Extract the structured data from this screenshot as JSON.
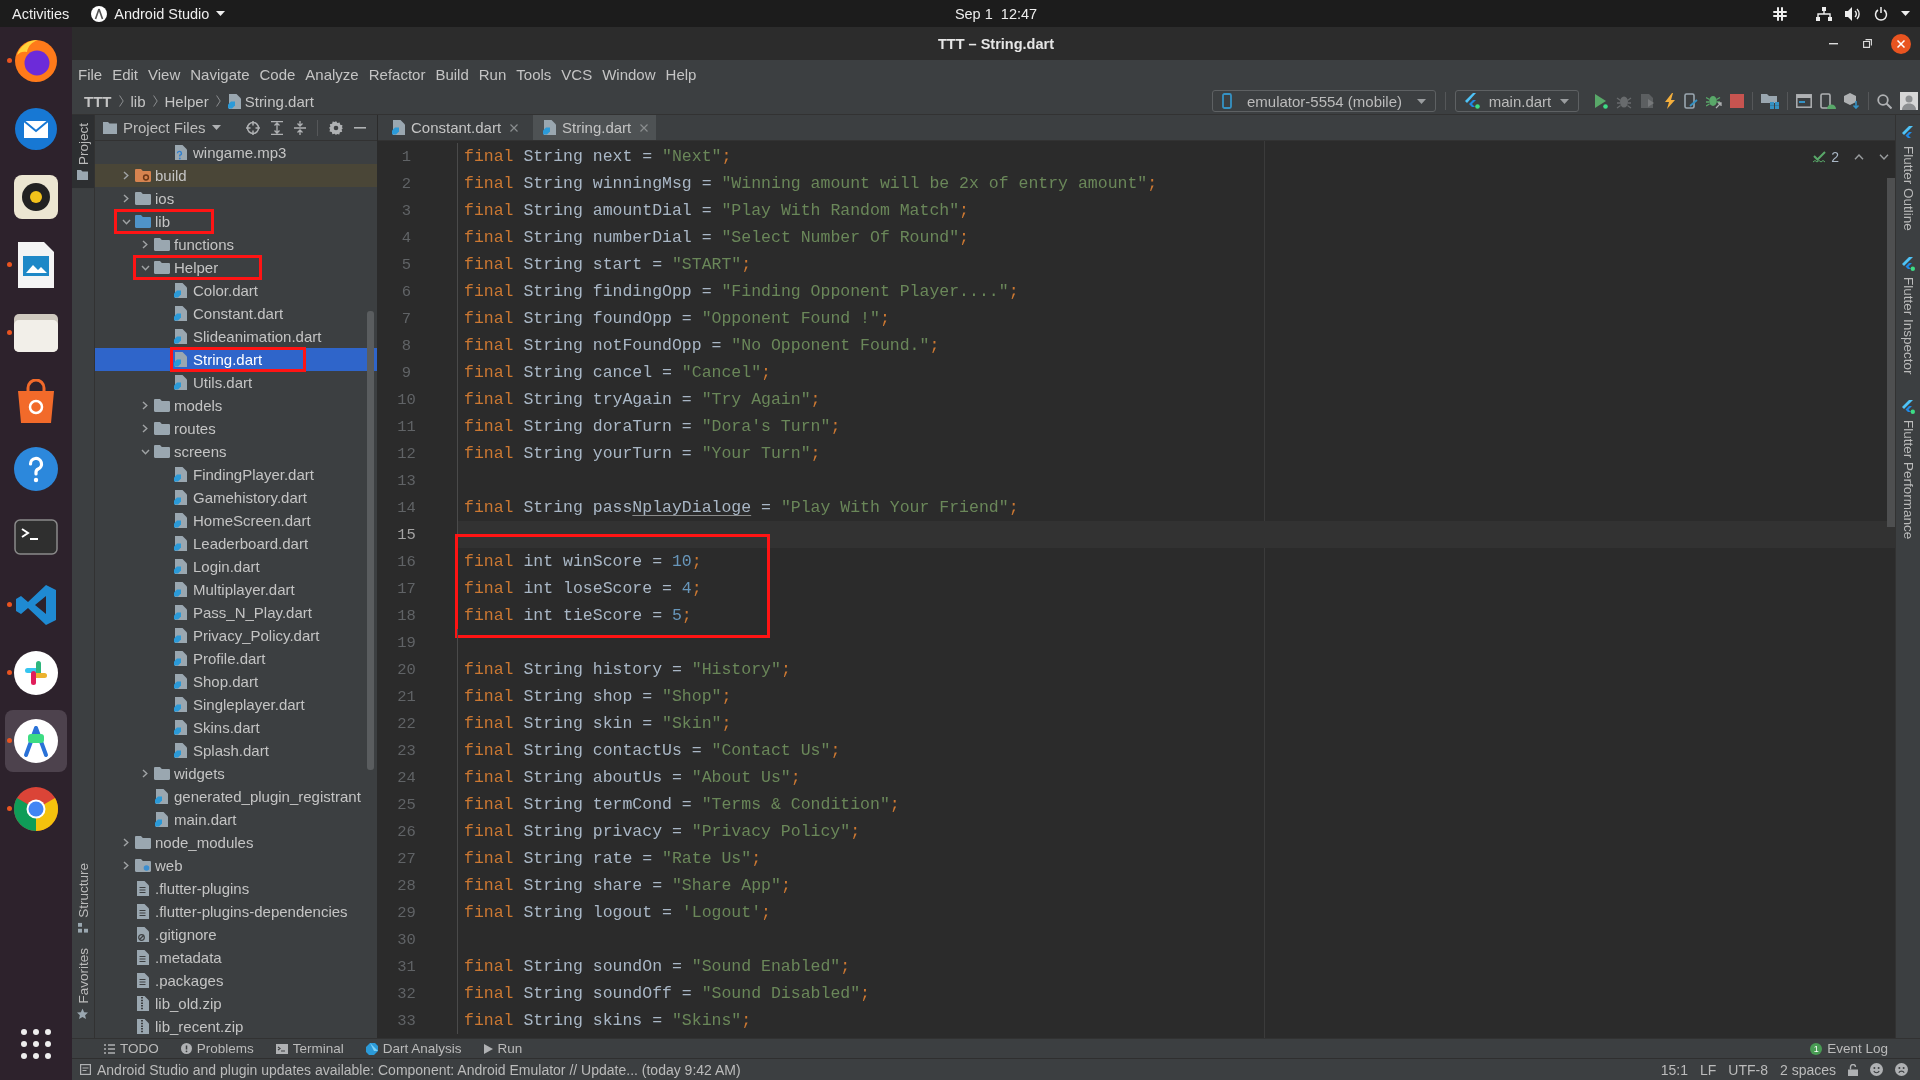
{
  "system_bar": {
    "activities": "Activities",
    "app_menu": "Android Studio",
    "clock": "Sep 1  12:47"
  },
  "dock": [
    {
      "kind": "browser",
      "running": true,
      "selected": false
    },
    {
      "kind": "mail",
      "running": false,
      "selected": false
    },
    {
      "kind": "music",
      "running": false,
      "selected": false
    },
    {
      "kind": "slides",
      "running": true,
      "selected": false
    },
    {
      "kind": "files",
      "running": true,
      "selected": false
    },
    {
      "kind": "store",
      "running": false,
      "selected": false
    },
    {
      "kind": "help",
      "running": false,
      "selected": false
    },
    {
      "kind": "terminal",
      "running": false,
      "selected": false
    },
    {
      "kind": "editor",
      "running": true,
      "selected": false
    },
    {
      "kind": "chat",
      "running": true,
      "selected": false
    },
    {
      "kind": "ide",
      "running": true,
      "selected": true
    },
    {
      "kind": "wheel",
      "running": true,
      "selected": false
    }
  ],
  "window": {
    "title": "TTT – String.dart"
  },
  "menu": [
    "File",
    "Edit",
    "View",
    "Navigate",
    "Code",
    "Analyze",
    "Refactor",
    "Build",
    "Run",
    "Tools",
    "VCS",
    "Window",
    "Help"
  ],
  "breadcrumbs": [
    {
      "kind": "project",
      "label": "TTT"
    },
    {
      "kind": "folder",
      "label": "lib"
    },
    {
      "kind": "folder",
      "label": "Helper"
    },
    {
      "kind": "dart",
      "label": "String.dart"
    }
  ],
  "run_toolbar": {
    "device": "emulator-5554 (mobile)",
    "configuration": "main.dart"
  },
  "left_tool_tabs": {
    "top": [
      {
        "kind": "project",
        "label": "Project",
        "selected": true
      }
    ],
    "bottom": [
      {
        "kind": "structure",
        "label": "Structure",
        "selected": false
      },
      {
        "kind": "favorites",
        "label": "Favorites",
        "selected": false
      }
    ]
  },
  "project": {
    "view": "Project Files",
    "tree": [
      {
        "children": [
          {
            "children": [
              {
                "label": "wingame.mp3",
                "kind": "unknown",
                "selected": false,
                "boxed": false
              }
            ]
          }
        ]
      },
      {
        "label": "build",
        "kind": "excluded",
        "expanded": false,
        "selected": false,
        "boxed": false
      },
      {
        "label": "ios",
        "kind": "folder",
        "expanded": false,
        "selected": false,
        "boxed": false
      },
      {
        "label": "lib",
        "kind": "source",
        "expanded": true,
        "selected": false,
        "boxed": true,
        "children": [
          {
            "label": "functions",
            "kind": "folder",
            "expanded": false,
            "selected": false,
            "boxed": false
          },
          {
            "label": "Helper",
            "kind": "folder",
            "expanded": true,
            "selected": false,
            "boxed": true,
            "children": [
              {
                "label": "Color.dart",
                "kind": "dart",
                "selected": false,
                "boxed": false
              },
              {
                "label": "Constant.dart",
                "kind": "dart",
                "selected": false,
                "boxed": false
              },
              {
                "label": "Slideanimation.dart",
                "kind": "dart",
                "selected": false,
                "boxed": false
              },
              {
                "label": "String.dart",
                "kind": "dart",
                "selected": true,
                "boxed": true
              },
              {
                "label": "Utils.dart",
                "kind": "dart",
                "selected": false,
                "boxed": false
              }
            ]
          },
          {
            "label": "models",
            "kind": "folder",
            "expanded": false,
            "selected": false,
            "boxed": false
          },
          {
            "label": "routes",
            "kind": "folder",
            "expanded": false,
            "selected": false,
            "boxed": false
          },
          {
            "label": "screens",
            "kind": "folder",
            "expanded": true,
            "selected": false,
            "boxed": false,
            "children": [
              {
                "label": "FindingPlayer.dart",
                "kind": "dart",
                "selected": false,
                "boxed": false
              },
              {
                "label": "Gamehistory.dart",
                "kind": "dart",
                "selected": false,
                "boxed": false
              },
              {
                "label": "HomeScreen.dart",
                "kind": "dart",
                "selected": false,
                "boxed": false
              },
              {
                "label": "Leaderboard.dart",
                "kind": "dart",
                "selected": false,
                "boxed": false
              },
              {
                "label": "Login.dart",
                "kind": "dart",
                "selected": false,
                "boxed": false
              },
              {
                "label": "Multiplayer.dart",
                "kind": "dart",
                "selected": false,
                "boxed": false
              },
              {
                "label": "Pass_N_Play.dart",
                "kind": "dart",
                "selected": false,
                "boxed": false
              },
              {
                "label": "Privacy_Policy.dart",
                "kind": "dart",
                "selected": false,
                "boxed": false
              },
              {
                "label": "Profile.dart",
                "kind": "dart",
                "selected": false,
                "boxed": false
              },
              {
                "label": "Shop.dart",
                "kind": "dart",
                "selected": false,
                "boxed": false
              },
              {
                "label": "Singleplayer.dart",
                "kind": "dart",
                "selected": false,
                "boxed": false
              },
              {
                "label": "Skins.dart",
                "kind": "dart",
                "selected": false,
                "boxed": false
              },
              {
                "label": "Splash.dart",
                "kind": "dart",
                "selected": false,
                "boxed": false
              }
            ]
          },
          {
            "label": "widgets",
            "kind": "folder",
            "expanded": false,
            "selected": false,
            "boxed": false
          },
          {
            "label": "generated_plugin_registrant",
            "kind": "dart",
            "selected": false,
            "boxed": false
          },
          {
            "label": "main.dart",
            "kind": "dart",
            "selected": false,
            "boxed": false
          }
        ]
      },
      {
        "label": "node_modules",
        "kind": "folder",
        "expanded": false,
        "selected": false,
        "boxed": false
      },
      {
        "label": "web",
        "kind": "web",
        "expanded": false,
        "selected": false,
        "boxed": false
      },
      {
        "label": ".flutter-plugins",
        "kind": "text",
        "selected": false,
        "boxed": false
      },
      {
        "label": ".flutter-plugins-dependencies",
        "kind": "text",
        "selected": false,
        "boxed": false
      },
      {
        "label": ".gitignore",
        "kind": "ignore",
        "selected": false,
        "boxed": false
      },
      {
        "label": ".metadata",
        "kind": "text",
        "selected": false,
        "boxed": false
      },
      {
        "label": ".packages",
        "kind": "text",
        "selected": false,
        "boxed": false
      },
      {
        "label": "lib_old.zip",
        "kind": "zip",
        "selected": false,
        "boxed": false
      },
      {
        "label": "lib_recent.zip",
        "kind": "zip",
        "selected": false,
        "boxed": false
      }
    ]
  },
  "editor": {
    "tabs": [
      {
        "label": "Constant.dart",
        "selected": false
      },
      {
        "label": "String.dart",
        "selected": true
      }
    ],
    "inspection_count": "2",
    "sections": [
      {
        "boxed": false,
        "lines": [
          {
            "number": "1",
            "current": false,
            "tokens": [
              {
                "kind": "keyword",
                "text": "final "
              },
              {
                "kind": "plain",
                "text": "String next = "
              },
              {
                "kind": "string",
                "text": "\"Next\""
              },
              {
                "kind": "keyword",
                "text": ";"
              }
            ]
          },
          {
            "number": "2",
            "current": false,
            "tokens": [
              {
                "kind": "keyword",
                "text": "final "
              },
              {
                "kind": "plain",
                "text": "String winningMsg = "
              },
              {
                "kind": "string",
                "text": "\"Winning amount will be 2x of entry amount\""
              },
              {
                "kind": "keyword",
                "text": ";"
              }
            ]
          },
          {
            "number": "3",
            "current": false,
            "tokens": [
              {
                "kind": "keyword",
                "text": "final "
              },
              {
                "kind": "plain",
                "text": "String amountDial = "
              },
              {
                "kind": "string",
                "text": "\"Play With Random Match\""
              },
              {
                "kind": "keyword",
                "text": ";"
              }
            ]
          },
          {
            "number": "4",
            "current": false,
            "tokens": [
              {
                "kind": "keyword",
                "text": "final "
              },
              {
                "kind": "plain",
                "text": "String numberDial = "
              },
              {
                "kind": "string",
                "text": "\"Select Number Of Round\""
              },
              {
                "kind": "keyword",
                "text": ";"
              }
            ]
          },
          {
            "number": "5",
            "current": false,
            "tokens": [
              {
                "kind": "keyword",
                "text": "final "
              },
              {
                "kind": "plain",
                "text": "String start = "
              },
              {
                "kind": "string",
                "text": "\"START\""
              },
              {
                "kind": "keyword",
                "text": ";"
              }
            ]
          },
          {
            "number": "6",
            "current": false,
            "tokens": [
              {
                "kind": "keyword",
                "text": "final "
              },
              {
                "kind": "plain",
                "text": "String findingOpp = "
              },
              {
                "kind": "string",
                "text": "\"Finding Opponent Player....\""
              },
              {
                "kind": "keyword",
                "text": ";"
              }
            ]
          },
          {
            "number": "7",
            "current": false,
            "tokens": [
              {
                "kind": "keyword",
                "text": "final "
              },
              {
                "kind": "plain",
                "text": "String foundOpp = "
              },
              {
                "kind": "string",
                "text": "\"Opponent Found !\""
              },
              {
                "kind": "keyword",
                "text": ";"
              }
            ]
          },
          {
            "number": "8",
            "current": false,
            "tokens": [
              {
                "kind": "keyword",
                "text": "final "
              },
              {
                "kind": "plain",
                "text": "String notFoundOpp = "
              },
              {
                "kind": "string",
                "text": "\"No Opponent Found.\""
              },
              {
                "kind": "keyword",
                "text": ";"
              }
            ]
          },
          {
            "number": "9",
            "current": false,
            "tokens": [
              {
                "kind": "keyword",
                "text": "final "
              },
              {
                "kind": "plain",
                "text": "String cancel = "
              },
              {
                "kind": "string",
                "text": "\"Cancel\""
              },
              {
                "kind": "keyword",
                "text": ";"
              }
            ]
          },
          {
            "number": "10",
            "current": false,
            "tokens": [
              {
                "kind": "keyword",
                "text": "final "
              },
              {
                "kind": "plain",
                "text": "String tryAgain = "
              },
              {
                "kind": "string",
                "text": "\"Try Again\""
              },
              {
                "kind": "keyword",
                "text": ";"
              }
            ]
          },
          {
            "number": "11",
            "current": false,
            "tokens": [
              {
                "kind": "keyword",
                "text": "final "
              },
              {
                "kind": "plain",
                "text": "String doraTurn = "
              },
              {
                "kind": "string",
                "text": "\"Dora's Turn\""
              },
              {
                "kind": "keyword",
                "text": ";"
              }
            ]
          },
          {
            "number": "12",
            "current": false,
            "tokens": [
              {
                "kind": "keyword",
                "text": "final "
              },
              {
                "kind": "plain",
                "text": "String yourTurn = "
              },
              {
                "kind": "string",
                "text": "\"Your Turn\""
              },
              {
                "kind": "keyword",
                "text": ";"
              }
            ]
          },
          {
            "number": "13",
            "current": false
          },
          {
            "number": "14",
            "current": false,
            "tokens": [
              {
                "kind": "keyword",
                "text": "final "
              },
              {
                "kind": "plain",
                "text": "String pass"
              },
              {
                "kind": "typo",
                "text": "NplayDialoge"
              },
              {
                "kind": "plain",
                "text": " = "
              },
              {
                "kind": "string",
                "text": "\"Play With Your Friend\""
              },
              {
                "kind": "keyword",
                "text": ";"
              }
            ]
          },
          {
            "number": "15",
            "current": true
          }
        ]
      },
      {
        "boxed": true,
        "lines": [
          {
            "number": "16",
            "current": false,
            "tokens": [
              {
                "kind": "keyword",
                "text": "final "
              },
              {
                "kind": "plain",
                "text": "int winScore = "
              },
              {
                "kind": "number",
                "text": "10"
              },
              {
                "kind": "keyword",
                "text": ";"
              }
            ]
          },
          {
            "number": "17",
            "current": false,
            "tokens": [
              {
                "kind": "keyword",
                "text": "final "
              },
              {
                "kind": "plain",
                "text": "int loseScore = "
              },
              {
                "kind": "number",
                "text": "4"
              },
              {
                "kind": "keyword",
                "text": ";"
              }
            ]
          },
          {
            "number": "18",
            "current": false,
            "tokens": [
              {
                "kind": "keyword",
                "text": "final "
              },
              {
                "kind": "plain",
                "text": "int tieScore = "
              },
              {
                "kind": "number",
                "text": "5"
              },
              {
                "kind": "keyword",
                "text": ";"
              }
            ]
          }
        ]
      },
      {
        "boxed": false,
        "lines": [
          {
            "number": "19",
            "current": false
          },
          {
            "number": "20",
            "current": false,
            "tokens": [
              {
                "kind": "keyword",
                "text": "final "
              },
              {
                "kind": "plain",
                "text": "String history = "
              },
              {
                "kind": "string",
                "text": "\"History\""
              },
              {
                "kind": "keyword",
                "text": ";"
              }
            ]
          },
          {
            "number": "21",
            "current": false,
            "tokens": [
              {
                "kind": "keyword",
                "text": "final "
              },
              {
                "kind": "plain",
                "text": "String shop = "
              },
              {
                "kind": "string",
                "text": "\"Shop\""
              },
              {
                "kind": "keyword",
                "text": ";"
              }
            ]
          },
          {
            "number": "22",
            "current": false,
            "tokens": [
              {
                "kind": "keyword",
                "text": "final "
              },
              {
                "kind": "plain",
                "text": "String skin = "
              },
              {
                "kind": "string",
                "text": "\"Skin\""
              },
              {
                "kind": "keyword",
                "text": ";"
              }
            ]
          },
          {
            "number": "23",
            "current": false,
            "tokens": [
              {
                "kind": "keyword",
                "text": "final "
              },
              {
                "kind": "plain",
                "text": "String contactUs = "
              },
              {
                "kind": "string",
                "text": "\"Contact Us\""
              },
              {
                "kind": "keyword",
                "text": ";"
              }
            ]
          },
          {
            "number": "24",
            "current": false,
            "tokens": [
              {
                "kind": "keyword",
                "text": "final "
              },
              {
                "kind": "plain",
                "text": "String aboutUs = "
              },
              {
                "kind": "string",
                "text": "\"About Us\""
              },
              {
                "kind": "keyword",
                "text": ";"
              }
            ]
          },
          {
            "number": "25",
            "current": false,
            "tokens": [
              {
                "kind": "keyword",
                "text": "final "
              },
              {
                "kind": "plain",
                "text": "String termCond = "
              },
              {
                "kind": "string",
                "text": "\"Terms & Condition\""
              },
              {
                "kind": "keyword",
                "text": ";"
              }
            ]
          },
          {
            "number": "26",
            "current": false,
            "tokens": [
              {
                "kind": "keyword",
                "text": "final "
              },
              {
                "kind": "plain",
                "text": "String privacy = "
              },
              {
                "kind": "string",
                "text": "\"Privacy Policy\""
              },
              {
                "kind": "keyword",
                "text": ";"
              }
            ]
          },
          {
            "number": "27",
            "current": false,
            "tokens": [
              {
                "kind": "keyword",
                "text": "final "
              },
              {
                "kind": "plain",
                "text": "String rate = "
              },
              {
                "kind": "string",
                "text": "\"Rate Us\""
              },
              {
                "kind": "keyword",
                "text": ";"
              }
            ]
          },
          {
            "number": "28",
            "current": false,
            "tokens": [
              {
                "kind": "keyword",
                "text": "final "
              },
              {
                "kind": "plain",
                "text": "String share = "
              },
              {
                "kind": "string",
                "text": "\"Share App\""
              },
              {
                "kind": "keyword",
                "text": ";"
              }
            ]
          },
          {
            "number": "29",
            "current": false,
            "tokens": [
              {
                "kind": "keyword",
                "text": "final "
              },
              {
                "kind": "plain",
                "text": "String logout = "
              },
              {
                "kind": "string",
                "text": "'Logout'"
              },
              {
                "kind": "keyword",
                "text": ";"
              }
            ]
          },
          {
            "number": "30",
            "current": false
          },
          {
            "number": "31",
            "current": false,
            "tokens": [
              {
                "kind": "keyword",
                "text": "final "
              },
              {
                "kind": "plain",
                "text": "String soundOn = "
              },
              {
                "kind": "string",
                "text": "\"Sound Enabled\""
              },
              {
                "kind": "keyword",
                "text": ";"
              }
            ]
          },
          {
            "number": "32",
            "current": false,
            "tokens": [
              {
                "kind": "keyword",
                "text": "final "
              },
              {
                "kind": "plain",
                "text": "String soundOff = "
              },
              {
                "kind": "string",
                "text": "\"Sound Disabled\""
              },
              {
                "kind": "keyword",
                "text": ";"
              }
            ]
          },
          {
            "number": "33",
            "current": false,
            "tokens": [
              {
                "kind": "keyword",
                "text": "final "
              },
              {
                "kind": "plain",
                "text": "String skins = "
              },
              {
                "kind": "string",
                "text": "\"Skins\""
              },
              {
                "kind": "keyword",
                "text": ";"
              }
            ]
          }
        ]
      }
    ]
  },
  "right_tool_tabs": [
    {
      "label": "Flutter Outline",
      "running": false
    },
    {
      "label": "Flutter Inspector",
      "running": true
    },
    {
      "label": "Flutter Performance",
      "running": true
    }
  ],
  "bottom_tools": [
    {
      "kind": "todo",
      "label": "TODO"
    },
    {
      "kind": "problems",
      "label": "Problems"
    },
    {
      "kind": "terminal",
      "label": "Terminal"
    },
    {
      "kind": "analysis",
      "label": "Dart Analysis"
    },
    {
      "kind": "run",
      "label": "Run"
    }
  ],
  "event_log": {
    "label": "Event Log",
    "count": "1"
  },
  "status_bar": {
    "message": "Android Studio and plugin updates available: Component: Android Emulator // Update... (today 9:42 AM)",
    "position": "15:1",
    "line_separator": "LF",
    "encoding": "UTF-8",
    "indent": "2 spaces"
  }
}
